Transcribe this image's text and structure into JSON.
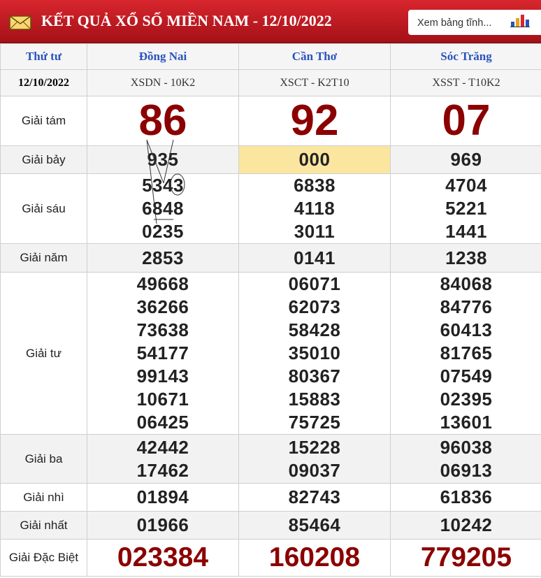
{
  "header": {
    "title": "KẾT QUẢ XỔ SỐ MIỀN NAM - 12/10/2022",
    "link_text": "Xem bảng tĩnh...",
    "mail_icon": "mail-icon",
    "chart_icon": "bar-chart-icon"
  },
  "table": {
    "day_label": "Thứ tư",
    "date": "12/10/2022",
    "provinces": [
      {
        "name": "Đồng Nai",
        "code": "XSDN - 10K2"
      },
      {
        "name": "Cần Thơ",
        "code": "XSCT - K2T10"
      },
      {
        "name": "Sóc Trăng",
        "code": "XSST - T10K2"
      }
    ],
    "prizes": [
      {
        "label": "Giải tám",
        "values": [
          [
            "86"
          ],
          [
            "92"
          ],
          [
            "07"
          ]
        ]
      },
      {
        "label": "Giải bảy",
        "values": [
          [
            "935"
          ],
          [
            "000"
          ],
          [
            "969"
          ]
        ]
      },
      {
        "label": "Giải sáu",
        "values": [
          [
            "5343",
            "6848",
            "0235"
          ],
          [
            "6838",
            "4118",
            "3011"
          ],
          [
            "4704",
            "5221",
            "1441"
          ]
        ]
      },
      {
        "label": "Giải năm",
        "values": [
          [
            "2853"
          ],
          [
            "0141"
          ],
          [
            "1238"
          ]
        ]
      },
      {
        "label": "Giải tư",
        "values": [
          [
            "49668",
            "36266",
            "73638",
            "54177",
            "99143",
            "10671",
            "06425"
          ],
          [
            "06071",
            "62073",
            "58428",
            "35010",
            "80367",
            "15883",
            "75725"
          ],
          [
            "84068",
            "84776",
            "60413",
            "81765",
            "07549",
            "02395",
            "13601"
          ]
        ]
      },
      {
        "label": "Giải ba",
        "values": [
          [
            "42442",
            "17462"
          ],
          [
            "15228",
            "09037"
          ],
          [
            "96038",
            "06913"
          ]
        ]
      },
      {
        "label": "Giải nhì",
        "values": [
          [
            "01894"
          ],
          [
            "82743"
          ],
          [
            "61836"
          ]
        ]
      },
      {
        "label": "Giải nhất",
        "values": [
          [
            "01966"
          ],
          [
            "85464"
          ],
          [
            "10242"
          ]
        ]
      },
      {
        "label": "Giải Đặc Biệt",
        "values": [
          [
            "023384"
          ],
          [
            "160208"
          ],
          [
            "779205"
          ]
        ]
      }
    ]
  },
  "colors": {
    "header_red": "#c4161c",
    "province_blue": "#2a52be",
    "prize_dark_red": "#8b0000",
    "highlight_yellow": "#fbe6a0"
  }
}
